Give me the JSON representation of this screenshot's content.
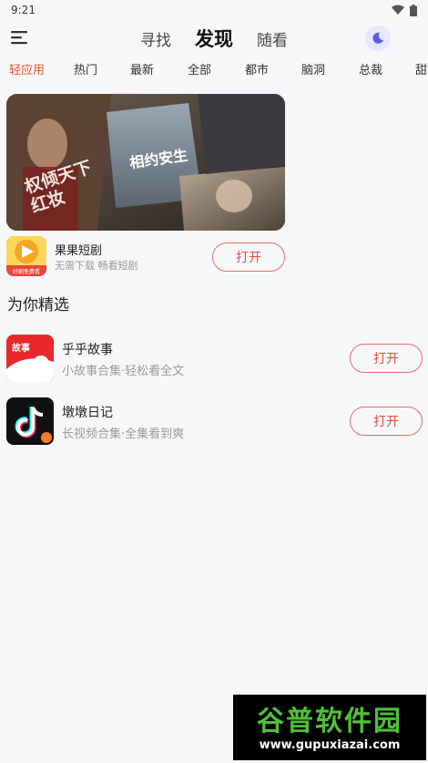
{
  "status_bar": {
    "time": "9:21"
  },
  "header": {
    "tabs": [
      {
        "label": "寻找",
        "active": false
      },
      {
        "label": "发现",
        "active": true
      },
      {
        "label": "随看",
        "active": false
      }
    ],
    "icons": {
      "menu": "menu-icon",
      "theme": "moon-icon"
    }
  },
  "categories": [
    {
      "label": "轻应用",
      "active": true
    },
    {
      "label": "热门",
      "active": false
    },
    {
      "label": "最新",
      "active": false
    },
    {
      "label": "全部",
      "active": false
    },
    {
      "label": "都市",
      "active": false
    },
    {
      "label": "脑洞",
      "active": false
    },
    {
      "label": "总裁",
      "active": false
    },
    {
      "label": "甜",
      "active": false
    }
  ],
  "featured": {
    "banner_text": "权倾天下 红妆",
    "banner_tag": "相约安生",
    "app": {
      "name": "果果短剧",
      "desc": "无需下载 畅看短剧",
      "button": "打开",
      "icon_text": "好剧免费看",
      "icon_bg": "#f39c2b"
    }
  },
  "section_title": "为你精选",
  "recommended": [
    {
      "name": "乎乎故事",
      "desc": "小故事合集·轻松看全文",
      "button": "打开",
      "icon_text": "故事",
      "icon_bg": "#e8282b"
    },
    {
      "name": "墩墩日记",
      "desc": "长视频合集·全集看到爽",
      "button": "打开",
      "icon_text": "♪",
      "icon_bg": "#111111"
    }
  ],
  "watermark": {
    "title": "谷普软件园",
    "url": "www.gupuxiazai.com"
  },
  "colors": {
    "accent": "#e8552e",
    "button_border": "#ec6a6a",
    "background": "#f6f7f9"
  }
}
